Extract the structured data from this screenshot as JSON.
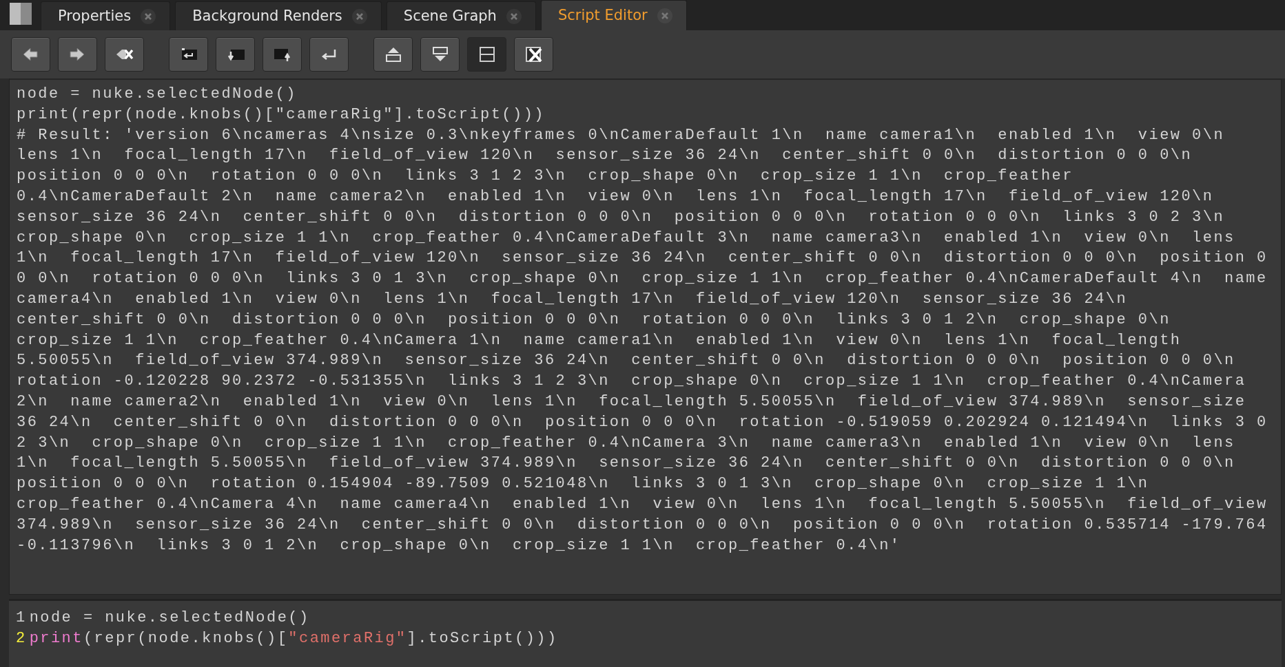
{
  "tabs": [
    {
      "label": "Properties",
      "selected": false,
      "closable": true
    },
    {
      "label": "Background Renders",
      "selected": false,
      "closable": true
    },
    {
      "label": "Scene Graph",
      "selected": false,
      "closable": true
    },
    {
      "label": "Script Editor",
      "selected": true,
      "closable": true
    }
  ],
  "toolbar": [
    [
      {
        "kind": "previous",
        "pressed": false
      },
      {
        "kind": "next",
        "pressed": false
      },
      {
        "kind": "clear-history",
        "pressed": false
      }
    ],
    [
      {
        "kind": "source",
        "pressed": false
      },
      {
        "kind": "load",
        "pressed": false
      },
      {
        "kind": "save",
        "pressed": false
      },
      {
        "kind": "run",
        "pressed": false
      }
    ],
    [
      {
        "kind": "show-input",
        "pressed": false
      },
      {
        "kind": "show-output",
        "pressed": false
      },
      {
        "kind": "split",
        "pressed": true
      },
      {
        "kind": "clear-output",
        "pressed": false
      }
    ]
  ],
  "output_lines": [
    "node = nuke.selectedNode()",
    "print(repr(node.knobs()[\"cameraRig\"].toScript()))",
    "# Result: 'version 6\\ncameras 4\\nsize 0.3\\nkeyframes 0\\nCameraDefault 1\\n  name camera1\\n  enabled 1\\n  view 0\\n",
    "lens 1\\n  focal_length 17\\n  field_of_view 120\\n  sensor_size 36 24\\n  center_shift 0 0\\n  distortion 0 0 0\\n",
    "position 0 0 0\\n  rotation 0 0 0\\n  links 3 1 2 3\\n  crop_shape 0\\n  crop_size 1 1\\n  crop_feather",
    "0.4\\nCameraDefault 2\\n  name camera2\\n  enabled 1\\n  view 0\\n  lens 1\\n  focal_length 17\\n  field_of_view 120\\n",
    "sensor_size 36 24\\n  center_shift 0 0\\n  distortion 0 0 0\\n  position 0 0 0\\n  rotation 0 0 0\\n  links 3 0 2 3\\n",
    "crop_shape 0\\n  crop_size 1 1\\n  crop_feather 0.4\\nCameraDefault 3\\n  name camera3\\n  enabled 1\\n  view 0\\n  lens",
    "1\\n  focal_length 17\\n  field_of_view 120\\n  sensor_size 36 24\\n  center_shift 0 0\\n  distortion 0 0 0\\n  position 0",
    "0 0\\n  rotation 0 0 0\\n  links 3 0 1 3\\n  crop_shape 0\\n  crop_size 1 1\\n  crop_feather 0.4\\nCameraDefault 4\\n  name",
    "camera4\\n  enabled 1\\n  view 0\\n  lens 1\\n  focal_length 17\\n  field_of_view 120\\n  sensor_size 36 24\\n",
    "center_shift 0 0\\n  distortion 0 0 0\\n  position 0 0 0\\n  rotation 0 0 0\\n  links 3 0 1 2\\n  crop_shape 0\\n",
    "crop_size 1 1\\n  crop_feather 0.4\\nCamera 1\\n  name camera1\\n  enabled 1\\n  view 0\\n  lens 1\\n  focal_length",
    "5.50055\\n  field_of_view 374.989\\n  sensor_size 36 24\\n  center_shift 0 0\\n  distortion 0 0 0\\n  position 0 0 0\\n",
    "rotation -0.120228 90.2372 -0.531355\\n  links 3 1 2 3\\n  crop_shape 0\\n  crop_size 1 1\\n  crop_feather 0.4\\nCamera",
    "2\\n  name camera2\\n  enabled 1\\n  view 0\\n  lens 1\\n  focal_length 5.50055\\n  field_of_view 374.989\\n  sensor_size",
    "36 24\\n  center_shift 0 0\\n  distortion 0 0 0\\n  position 0 0 0\\n  rotation -0.519059 0.202924 0.121494\\n  links 3 0",
    "2 3\\n  crop_shape 0\\n  crop_size 1 1\\n  crop_feather 0.4\\nCamera 3\\n  name camera3\\n  enabled 1\\n  view 0\\n  lens",
    "1\\n  focal_length 5.50055\\n  field_of_view 374.989\\n  sensor_size 36 24\\n  center_shift 0 0\\n  distortion 0 0 0\\n",
    "position 0 0 0\\n  rotation 0.154904 -89.7509 0.521048\\n  links 3 0 1 3\\n  crop_shape 0\\n  crop_size 1 1\\n",
    "crop_feather 0.4\\nCamera 4\\n  name camera4\\n  enabled 1\\n  view 0\\n  lens 1\\n  focal_length 5.50055\\n  field_of_view",
    "374.989\\n  sensor_size 36 24\\n  center_shift 0 0\\n  distortion 0 0 0\\n  position 0 0 0\\n  rotation 0.535714 -179.764",
    "-0.113796\\n  links 3 0 1 2\\n  crop_shape 0\\n  crop_size 1 1\\n  crop_feather 0.4\\n'"
  ],
  "input_lines": [
    {
      "number": "1",
      "current": false,
      "tokens": [
        {
          "kind": "plain",
          "text": "node = nuke.selectedNode()"
        }
      ]
    },
    {
      "number": "2",
      "current": true,
      "tokens": [
        {
          "kind": "keyword",
          "text": "print"
        },
        {
          "kind": "plain",
          "text": "(repr(node.knobs()["
        },
        {
          "kind": "string",
          "text": "\"cameraRig\""
        },
        {
          "kind": "plain",
          "text": "].toScript()))"
        }
      ]
    }
  ]
}
